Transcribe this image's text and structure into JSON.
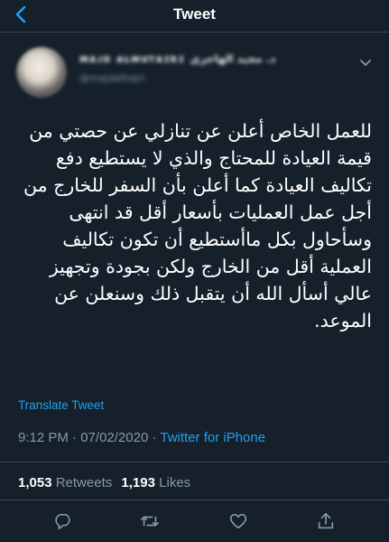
{
  "header": {
    "title": "Tweet"
  },
  "author": {
    "name": "ᴍᴀᴊᴅ ᴀʟᴍᴜᴛᴀɪʀɪ  د. مجيد الهاجري",
    "handle": "@majdalhajri"
  },
  "tweet": {
    "text": "للعمل الخاص أعلن عن تنازلي عن حصتي من قيمة العيادة للمحتاج والذي لا يستطيع دفع تكاليف العيادة كما أعلن بأن السفر للخارج من أجل عمل العمليات بأسعار أقل قد انتهى وسأحاول بكل ماأستطيع أن تكون تكاليف العملية أقل من الخارج ولكن بجودة وتجهيز عالي أسأل الله أن يتقبل ذلك وسنعلن عن الموعد."
  },
  "translate_label": "Translate Tweet",
  "meta": {
    "time": "9:12 PM",
    "separator1": " · ",
    "date": "07/02/2020",
    "separator2": " · ",
    "source": "Twitter for iPhone"
  },
  "stats": {
    "retweets_count": "1,053",
    "retweets_label": "Retweets",
    "likes_count": "1,193",
    "likes_label": "Likes"
  },
  "icons": {
    "back": "chevron-left-icon",
    "more": "chevron-down-icon",
    "reply": "reply-icon",
    "retweet": "retweet-icon",
    "like": "heart-icon",
    "share": "share-icon"
  },
  "colors": {
    "background": "#15202b",
    "accent": "#1da1f2",
    "secondary_text": "#8899a6",
    "divider": "#38444d"
  }
}
